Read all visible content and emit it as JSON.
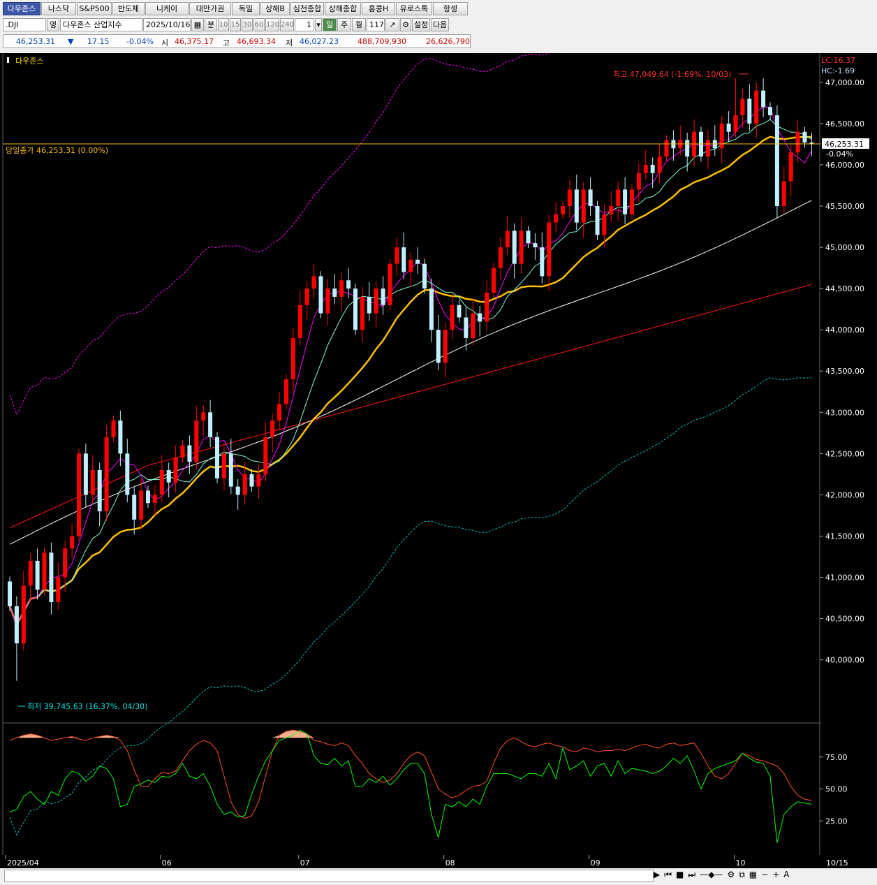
{
  "toolbar": {
    "tabs": [
      "다우존스",
      "나스닥",
      "S&P500",
      "반도체",
      "니케이",
      "대만가권",
      "독일",
      "상해B",
      "심천종합",
      "상해종합",
      "홍콩H",
      "유로스톡",
      "항셍"
    ],
    "active_tab": 0,
    "symbol_code": ".DJI",
    "symbol_lang": "영",
    "symbol_name": "다우존스 산업지수",
    "date": "2025/10/16",
    "period_buttons": [
      "분",
      "10",
      "15",
      "30",
      "60",
      "120",
      "240"
    ],
    "period_count": "1",
    "period_units": [
      "일",
      "주",
      "월"
    ],
    "selected_unit": "일",
    "bar_count": "117",
    "settings_label": "설정",
    "next_label": "다음"
  },
  "quote": {
    "price": "46,253.31",
    "direction_symbol": "▼",
    "change": "17.15",
    "change_pct": "-0.04%",
    "open_label": "시",
    "open": "46,375.17",
    "high_label": "고",
    "high": "46,693.34",
    "low_label": "저",
    "low": "46,027.23",
    "volume": "488,709,930",
    "amount": "26,626,790"
  },
  "chart_data": {
    "type": "candlestick",
    "title": "다우존스",
    "ylim": [
      39650,
      47100
    ],
    "yticks": [
      40000,
      40500,
      41000,
      41500,
      42000,
      42500,
      43000,
      43500,
      44000,
      44500,
      45000,
      45500,
      46000,
      46500,
      47000
    ],
    "ytick_labels": [
      "40,000.00",
      "40,500.00",
      "41,000.00",
      "41,500.00",
      "42,000.00",
      "42,500.00",
      "43,000.00",
      "43,500.00",
      "44,000.00",
      "44,500.00",
      "45,000.00",
      "45,500.00",
      "46,000.00",
      "46,500.00",
      "47,000.00"
    ],
    "x_labels": [
      {
        "index": 0,
        "label": "2025/04"
      },
      {
        "index": 22,
        "label": "06"
      },
      {
        "index": 42,
        "label": "07"
      },
      {
        "index": 63,
        "label": "08"
      },
      {
        "index": 84,
        "label": "09"
      },
      {
        "index": 105,
        "label": "10"
      },
      {
        "index": 116,
        "label": "10/15"
      }
    ],
    "close": [
      40650,
      40200,
      40900,
      41200,
      40850,
      41300,
      40700,
      41000,
      41350,
      41500,
      42500,
      42000,
      42300,
      41800,
      42700,
      42900,
      42500,
      42000,
      41700,
      42050,
      41900,
      42000,
      42300,
      42150,
      42450,
      42600,
      42400,
      42900,
      43000,
      42700,
      42200,
      42500,
      42100,
      42000,
      42250,
      42100,
      42250,
      42700,
      42900,
      43100,
      43400,
      43900,
      44300,
      44500,
      44650,
      44200,
      44500,
      44400,
      44600,
      44500,
      44000,
      44400,
      44200,
      44500,
      44300,
      44800,
      45000,
      44700,
      44850,
      44800,
      44500,
      44000,
      43600,
      44000,
      44300,
      44150,
      43900,
      44200,
      44100,
      44450,
      44750,
      45000,
      45200,
      44800,
      45200,
      45050,
      45000,
      44650,
      45300,
      45400,
      45500,
      45700,
      45300,
      45700,
      45500,
      45150,
      45400,
      45500,
      45700,
      45400,
      45700,
      45900,
      46000,
      45900,
      46100,
      46300,
      46200,
      46300,
      46100,
      46400,
      46100,
      46300,
      46200,
      46500,
      46400,
      46600,
      46800,
      46500,
      46900,
      46700,
      46600,
      45500,
      45800,
      46150,
      46400,
      46270,
      46253
    ],
    "ohlc_note": "daily candles, 117 bars",
    "high_marker": {
      "label": "최고 47,049.64 (-1.69%, 10/03)",
      "value": 47049.64,
      "index": 105
    },
    "low_marker": {
      "label": "최저 39,745.63 (16.37%, 04/30)",
      "value": 39745.63,
      "index": 1
    },
    "current_line": {
      "label": "당일종가 46,253.31 (0.00%)",
      "value": 46253.31,
      "tag": "46,253.31",
      "tag_change": "-0.04%"
    },
    "corner_labels": {
      "lc": "LC:16.37",
      "hc": "HC:-1.69"
    },
    "lower": {
      "ylim": [
        0,
        100
      ],
      "yticks": [
        25,
        50,
        75
      ],
      "ytick_labels": [
        "25.00",
        "50.00",
        "75.00"
      ],
      "slow_k": [
        88,
        90,
        92,
        93,
        92,
        90,
        88,
        89,
        90,
        91,
        89,
        88,
        90,
        91,
        92,
        91,
        88,
        80,
        65,
        52,
        52,
        58,
        63,
        62,
        64,
        72,
        80,
        85,
        88,
        86,
        80,
        60,
        40,
        30,
        27,
        29,
        40,
        60,
        80,
        92,
        95,
        96,
        95,
        93,
        88,
        87,
        85,
        84,
        86,
        84,
        76,
        70,
        62,
        58,
        55,
        57,
        62,
        70,
        76,
        79,
        76,
        63,
        50,
        46,
        43,
        45,
        49,
        52,
        53,
        56,
        70,
        82,
        88,
        90,
        87,
        84,
        83,
        85,
        86,
        84,
        83,
        80,
        79,
        82,
        81,
        79,
        80,
        80,
        81,
        80,
        82,
        84,
        85,
        83,
        82,
        85,
        86,
        84,
        85,
        86,
        78,
        68,
        60,
        58,
        62,
        70,
        78,
        76,
        73,
        72,
        70,
        68,
        62,
        52,
        45,
        42,
        41
      ],
      "slow_d": [
        32,
        34,
        44,
        48,
        42,
        38,
        48,
        45,
        58,
        64,
        62,
        56,
        60,
        68,
        66,
        58,
        36,
        38,
        52,
        54,
        57,
        55,
        60,
        59,
        62,
        70,
        60,
        58,
        62,
        52,
        38,
        30,
        32,
        28,
        29,
        46,
        60,
        72,
        80,
        88,
        90,
        92,
        96,
        93,
        76,
        70,
        69,
        74,
        68,
        72,
        52,
        52,
        58,
        55,
        60,
        53,
        58,
        65,
        70,
        70,
        62,
        30,
        12,
        38,
        36,
        40,
        36,
        42,
        38,
        52,
        62,
        62,
        62,
        60,
        58,
        62,
        62,
        60,
        70,
        58,
        82,
        65,
        68,
        72,
        60,
        68,
        70,
        60,
        72,
        62,
        66,
        65,
        64,
        62,
        64,
        68,
        74,
        70,
        76,
        64,
        50,
        62,
        66,
        68,
        70,
        72,
        78,
        74,
        71,
        70,
        60,
        8,
        30,
        36,
        40,
        39,
        38
      ]
    }
  },
  "colors": {
    "background": "#000000",
    "up": "#ff0000",
    "down": "#c0f0ff",
    "ma5": "#ff00ff",
    "ma10": "#7fffd4",
    "ma20": "#ffc000",
    "ma60": "#ffffff",
    "ma120": "#e01010",
    "env_upper": "#ff00ff",
    "env_lower": "#00c0c0",
    "current_line": "#ffc000",
    "slow_k": "#ff5020",
    "slow_d": "#00ff00"
  }
}
